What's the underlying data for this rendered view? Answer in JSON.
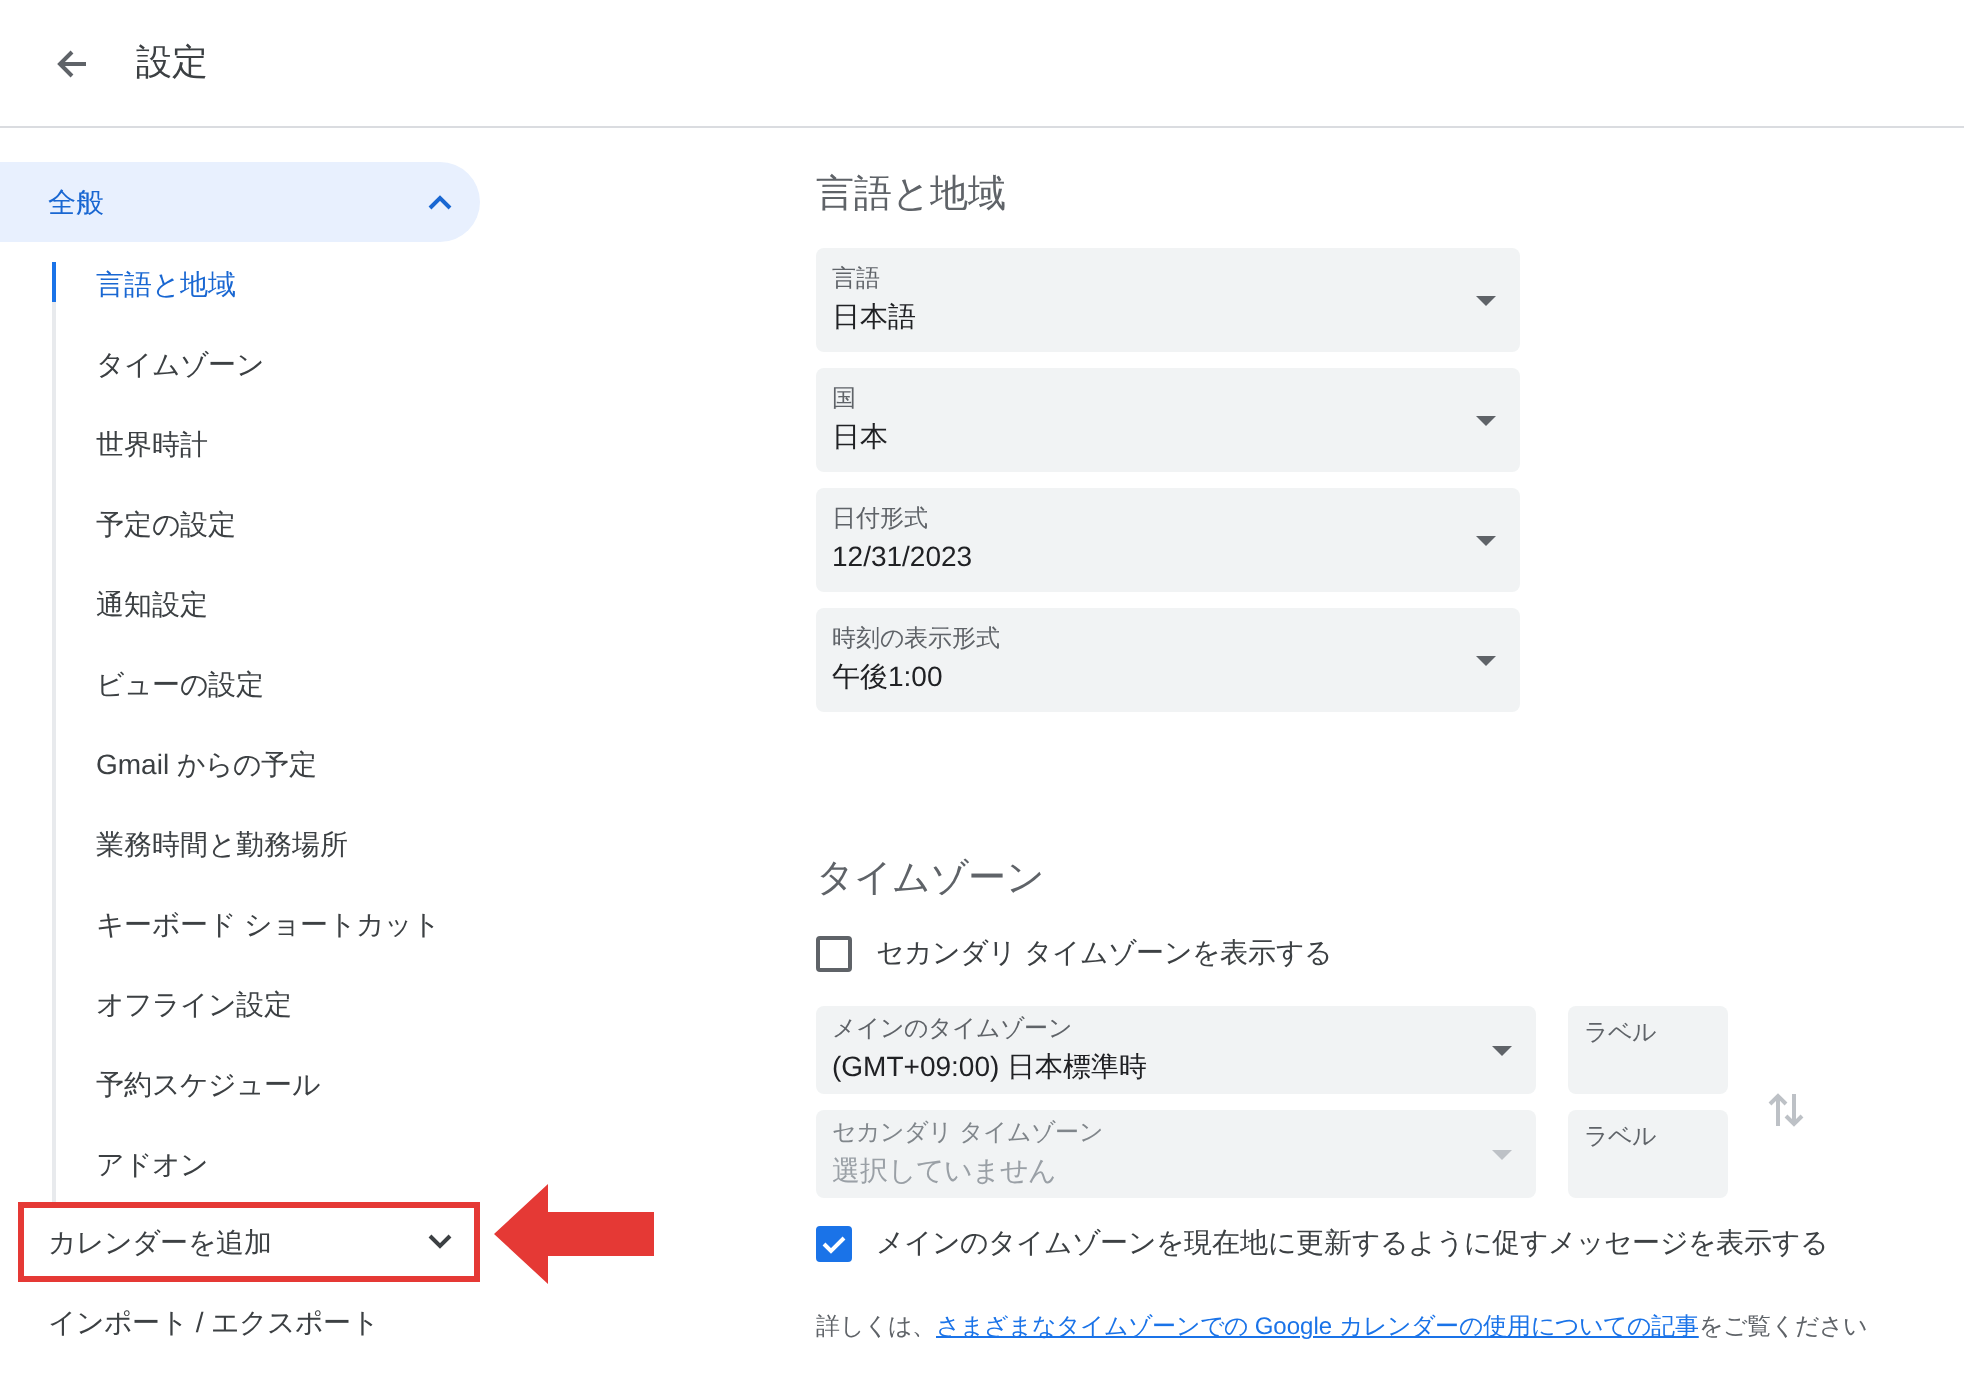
{
  "header": {
    "title": "設定"
  },
  "sidebar": {
    "items": [
      {
        "kind": "group",
        "label": "全般",
        "expanded": true,
        "highlighted": false,
        "children": [
          {
            "label": "言語と地域",
            "selected": true
          },
          {
            "label": "タイムゾーン",
            "selected": false
          },
          {
            "label": "世界時計",
            "selected": false
          },
          {
            "label": "予定の設定",
            "selected": false
          },
          {
            "label": "通知設定",
            "selected": false
          },
          {
            "label": "ビューの設定",
            "selected": false
          },
          {
            "label": "Gmail からの予定",
            "selected": false
          },
          {
            "label": "業務時間と勤務場所",
            "selected": false
          },
          {
            "label": "キーボード ショートカット",
            "selected": false
          },
          {
            "label": "オフライン設定",
            "selected": false
          },
          {
            "label": "予約スケジュール",
            "selected": false
          },
          {
            "label": "アドオン",
            "selected": false
          }
        ]
      },
      {
        "kind": "group",
        "label": "カレンダーを追加",
        "expanded": false,
        "highlighted": true
      },
      {
        "kind": "link",
        "label": "インポート / エクスポート",
        "highlighted": false
      }
    ]
  },
  "language_region": {
    "title": "言語と地域",
    "selects": [
      {
        "label": "言語",
        "value": "日本語"
      },
      {
        "label": "国",
        "value": "日本"
      },
      {
        "label": "日付形式",
        "value": "12/31/2023"
      },
      {
        "label": "時刻の表示形式",
        "value": "午後1:00"
      }
    ]
  },
  "time_zone": {
    "title": "タイムゾーン",
    "secondary_checkbox": {
      "label": "セカンダリ タイムゾーンを表示する",
      "checked": false
    },
    "zones": [
      {
        "label": "メインのタイムゾーン",
        "value": "(GMT+09:00) 日本標準時",
        "disabled": false,
        "zone_label": {
          "placeholder": "ラベル"
        }
      },
      {
        "label": "セカンダリ タイムゾーン",
        "value": "選択していません",
        "disabled": true,
        "zone_label": {
          "placeholder": "ラベル"
        }
      }
    ],
    "prompt_checkbox": {
      "label": "メインのタイムゾーンを現在地に更新するように促すメッセージを表示する",
      "checked": true
    },
    "footnote": {
      "before": "詳しくは、",
      "link": "さまざまなタイムゾーンでの Google カレンダーの使用についての記事",
      "after": "をご覧ください"
    }
  }
}
